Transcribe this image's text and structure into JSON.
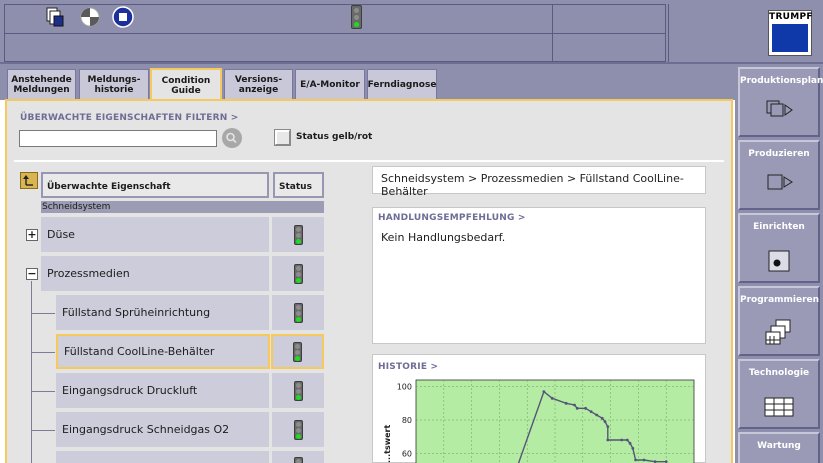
{
  "header": {
    "logo_text": "TRUMPF"
  },
  "icons": {
    "copy": "copy-pages-icon",
    "halfcircle": "quarter-circle-icon",
    "stop": "stop-icon",
    "signal": "traffic-light-icon"
  },
  "tabs": [
    {
      "label": "Anstehende\nMeldungen"
    },
    {
      "label": "Meldungs-\nhistorie"
    },
    {
      "label": "Condition\nGuide"
    },
    {
      "label": "Versions-\nanzeige"
    },
    {
      "label": "E/A-Monitor"
    },
    {
      "label": "Ferndiagnose"
    }
  ],
  "nav": [
    {
      "label": "Produktionsplan"
    },
    {
      "label": "Produzieren"
    },
    {
      "label": "Einrichten"
    },
    {
      "label": "Programmieren"
    },
    {
      "label": "Technologie"
    },
    {
      "label": "Wartung"
    }
  ],
  "filter": {
    "title": "ÜBERWACHTE EIGENSCHAFTEN FILTERN >",
    "value": "",
    "status_label": "Status gelb/rot"
  },
  "tree": {
    "col_property": "Überwachte Eigenschaft",
    "col_status": "Status",
    "group": "Schneidsystem",
    "rows": [
      {
        "label": "Düse",
        "expander": "+"
      },
      {
        "label": "Prozessmedien",
        "expander": "−"
      },
      {
        "label": "Füllstand Sprüheinrichtung"
      },
      {
        "label": "Füllstand CoolLine-Behälter"
      },
      {
        "label": "Eingangsdruck Druckluft"
      },
      {
        "label": "Eingangsdruck Schneidgas O2"
      }
    ]
  },
  "detail": {
    "breadcrumb": "Schneidsystem > Prozessmedien > Füllstand CoolLine-Behälter",
    "recommendation_title": "HANDLUNGSEMPFEHLUNG >",
    "recommendation_text": "Kein Handlungsbedarf.",
    "history_title": "HISTORIE >"
  },
  "colors": {
    "accent": "#f5c95c",
    "chrome": "#8e8ead",
    "chart_bg": "#b4eca4",
    "series": "#555577"
  },
  "chart_data": {
    "type": "line",
    "ylabel": "...tswert",
    "yticks": [
      100,
      80,
      60
    ],
    "ylim": [
      50,
      104
    ],
    "xlim": [
      0,
      100
    ],
    "grid": true,
    "series": [
      {
        "points": [
          [
            36,
            50
          ],
          [
            46,
            97
          ],
          [
            49,
            93
          ],
          [
            54,
            90
          ],
          [
            57,
            89
          ],
          [
            58,
            87
          ],
          [
            61,
            87
          ],
          [
            63,
            85
          ],
          [
            65,
            83
          ],
          [
            67,
            81
          ],
          [
            68,
            79
          ],
          [
            69,
            76
          ],
          [
            69,
            68
          ],
          [
            74,
            68
          ],
          [
            76,
            68
          ],
          [
            77,
            66
          ],
          [
            78,
            63
          ],
          [
            79,
            56
          ],
          [
            82,
            56
          ],
          [
            86,
            55
          ],
          [
            90,
            55
          ]
        ]
      }
    ]
  }
}
